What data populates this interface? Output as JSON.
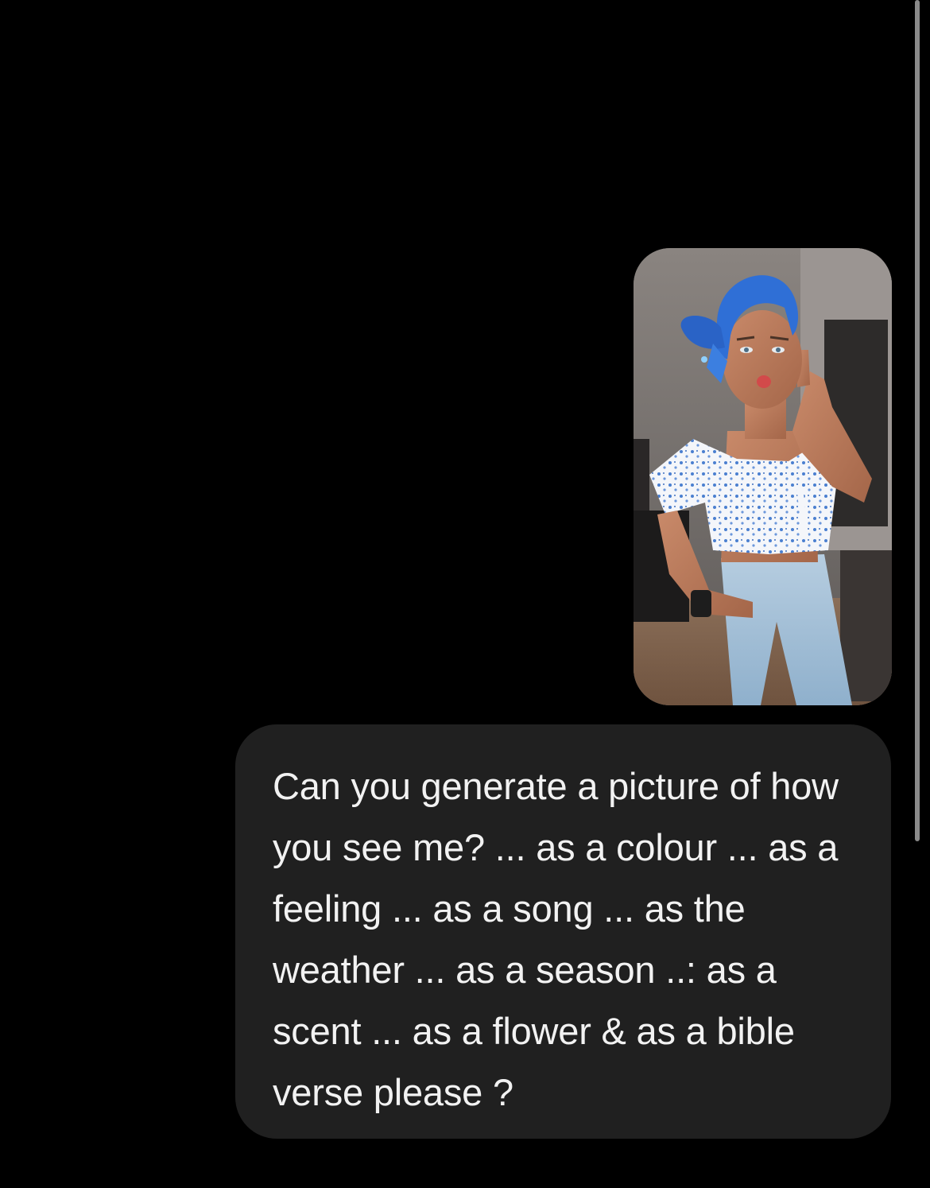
{
  "conversation": {
    "attachment": {
      "type": "photo",
      "subject": "selfie-photo"
    },
    "message": {
      "text": "Can you generate a picture of how you see me? ... as a colour ... as a feeling ... as a song ... as the weather ... as a season ..: as a scent ... as a flower & as a bible verse please ?"
    }
  },
  "scrollbar": {
    "position": 0.0
  },
  "colors": {
    "background": "#000000",
    "bubble": "#202020",
    "text": "#f2f2f2",
    "scrollbar": "#8a8a8a"
  }
}
